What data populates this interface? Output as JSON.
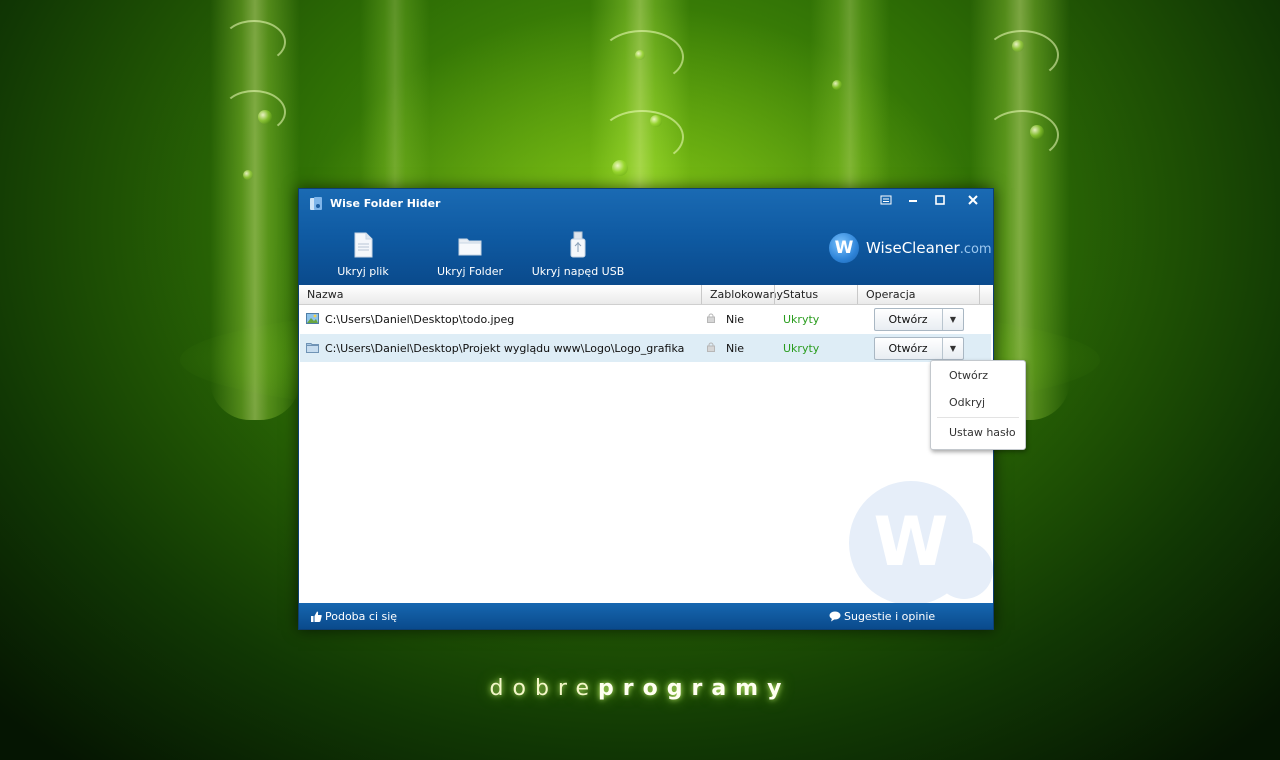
{
  "window": {
    "title": "Wise Folder Hider"
  },
  "toolbar": {
    "hide_file": "Ukryj plik",
    "hide_folder": "Ukryj Folder",
    "hide_usb": "Ukryj napęd USB"
  },
  "logo": {
    "letter": "W",
    "name": "WiseCleaner",
    "suffix": ".com"
  },
  "columns": {
    "name": "Nazwa",
    "locked": "Zablokowany",
    "status": "Status",
    "operation": "Operacja"
  },
  "rows": [
    {
      "path": "C:\\Users\\Daniel\\Desktop\\todo.jpeg",
      "locked": "Nie",
      "status": "Ukryty",
      "button": "Otwórz",
      "icon": "image-file-icon"
    },
    {
      "path": "C:\\Users\\Daniel\\Desktop\\Projekt wyglądu www\\Logo\\Logo_grafika",
      "locked": "Nie",
      "status": "Ukryty",
      "button": "Otwórz",
      "icon": "folder-icon"
    }
  ],
  "dropdown_menu": {
    "open": "Otwórz",
    "unhide": "Odkryj",
    "set_password": "Ustaw hasło"
  },
  "footer": {
    "like": "Podoba ci się",
    "feedback": "Sugestie i opinie"
  },
  "watermark": {
    "letter": "W"
  },
  "desktop": {
    "brand_light": "dobre",
    "brand_bold": "programy"
  },
  "colors": {
    "header_blue": "#0f5aa2",
    "status_green": "#2a9d1e",
    "selected_row": "#deedf6"
  }
}
